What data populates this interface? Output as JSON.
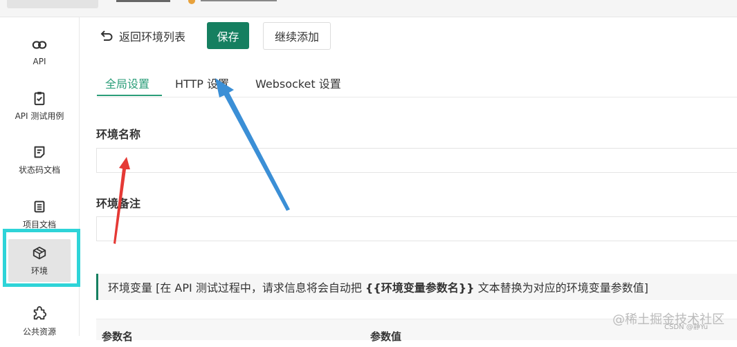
{
  "sidebar": {
    "items": [
      {
        "label": "API",
        "icon": "link-icon"
      },
      {
        "label": "API 测试用例",
        "icon": "clipboard-check-icon"
      },
      {
        "label": "状态码文档",
        "icon": "document-icon"
      },
      {
        "label": "项目文档",
        "icon": "list-document-icon"
      },
      {
        "label": "环境",
        "icon": "cube-icon",
        "active": true
      },
      {
        "label": "公共资源",
        "icon": "puzzle-icon"
      }
    ]
  },
  "toolbar": {
    "back_label": "返回环境列表",
    "save_label": "保存",
    "continue_label": "继续添加"
  },
  "tabs": [
    {
      "label": "全局设置",
      "active": true
    },
    {
      "label": "HTTP 设置"
    },
    {
      "label": "Websocket 设置"
    }
  ],
  "form": {
    "name_label": "环境名称",
    "name_value": "",
    "note_label": "环境备注",
    "note_value": ""
  },
  "notice": {
    "prefix": "环境变量 [在 API 测试过程中，请求信息将会自动把 ",
    "highlight": "{{环境变量参数名}}",
    "suffix": " 文本替换为对应的环境变量参数值]"
  },
  "table": {
    "headers": [
      "参数名",
      "参数值"
    ]
  },
  "watermark": {
    "main": "@稀土掘金技术社区",
    "sub": "CSDN @静Yu"
  },
  "colors": {
    "accent": "#157f60",
    "tab_active": "#2a9d78",
    "highlight_box": "#2ed4d8",
    "annotation_blue": "#3b8fd6",
    "annotation_red": "#e53935"
  }
}
